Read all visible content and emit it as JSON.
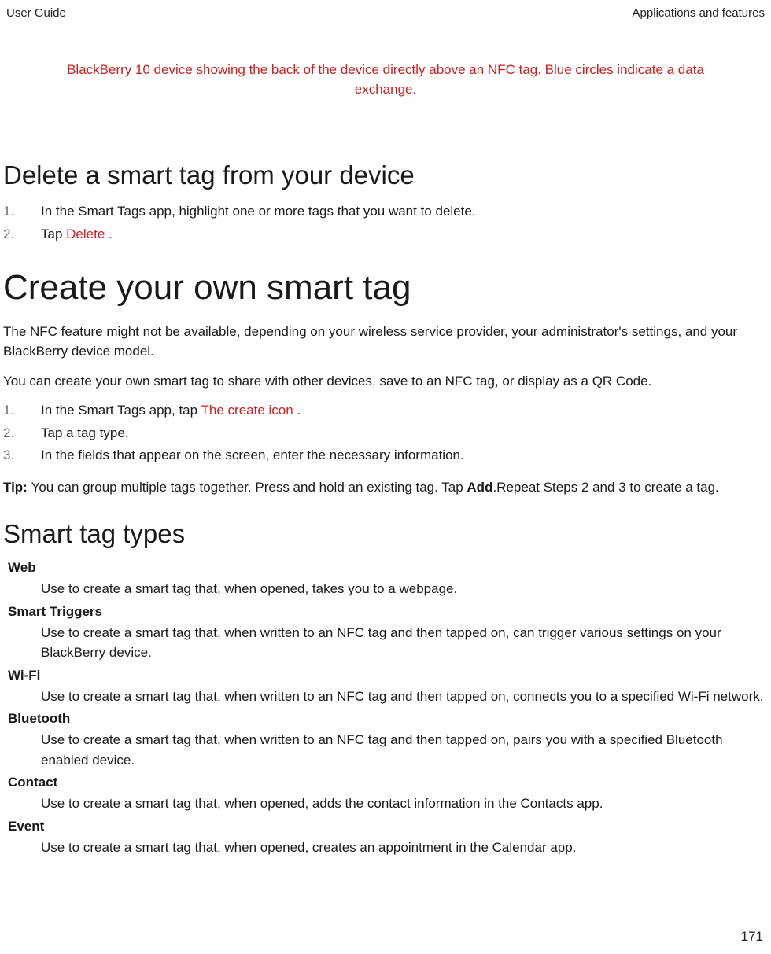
{
  "header": {
    "left": "User Guide",
    "right": "Applications and features"
  },
  "caption": "BlackBerry 10 device showing the back of the device directly above an NFC tag. Blue circles indicate a data exchange.",
  "deleteSection": {
    "heading": "Delete a smart tag from your device",
    "step1": "In the Smart Tags app, highlight one or more tags that you want to delete.",
    "step2_pre": "Tap ",
    "step2_icon": " Delete ",
    "step2_post": "."
  },
  "createSection": {
    "heading": "Create your own smart tag",
    "para1": "The NFC feature might not be available, depending on your wireless service provider, your administrator's settings, and your BlackBerry device model.",
    "para2": "You can create your own smart tag to share with other devices, save to an NFC tag, or display as a QR Code.",
    "step1_pre": "In the Smart Tags app, tap ",
    "step1_icon": " The create icon ",
    "step1_post": ".",
    "step2": "Tap a tag type.",
    "step3": "In the fields that appear on the screen, enter the necessary information.",
    "tip_label": "Tip: ",
    "tip_pre": "You can group multiple tags together. Press and hold an existing tag. Tap ",
    "tip_bold": "Add",
    "tip_post": ".Repeat Steps 2 and 3 to create a tag."
  },
  "typesSection": {
    "heading": "Smart tag types",
    "items": [
      {
        "term": "Web",
        "desc": "Use to create a smart tag that, when opened, takes you to a webpage."
      },
      {
        "term": "Smart Triggers",
        "desc": "Use to create a smart tag that, when written to an NFC tag and then tapped on, can trigger various settings on your BlackBerry device."
      },
      {
        "term": "Wi-Fi",
        "desc": "Use to create a smart tag that, when written to an NFC tag and then tapped on, connects you to a specified Wi-Fi network."
      },
      {
        "term": "Bluetooth",
        "desc": "Use to create a smart tag that, when written to an NFC tag and then tapped on, pairs you with a specified Bluetooth enabled device."
      },
      {
        "term": "Contact",
        "desc": "Use to create a smart tag that, when opened, adds the contact information in the Contacts app."
      },
      {
        "term": "Event",
        "desc": "Use to create a smart tag that, when opened, creates an appointment in the Calendar app."
      }
    ]
  },
  "pageNumber": "171"
}
